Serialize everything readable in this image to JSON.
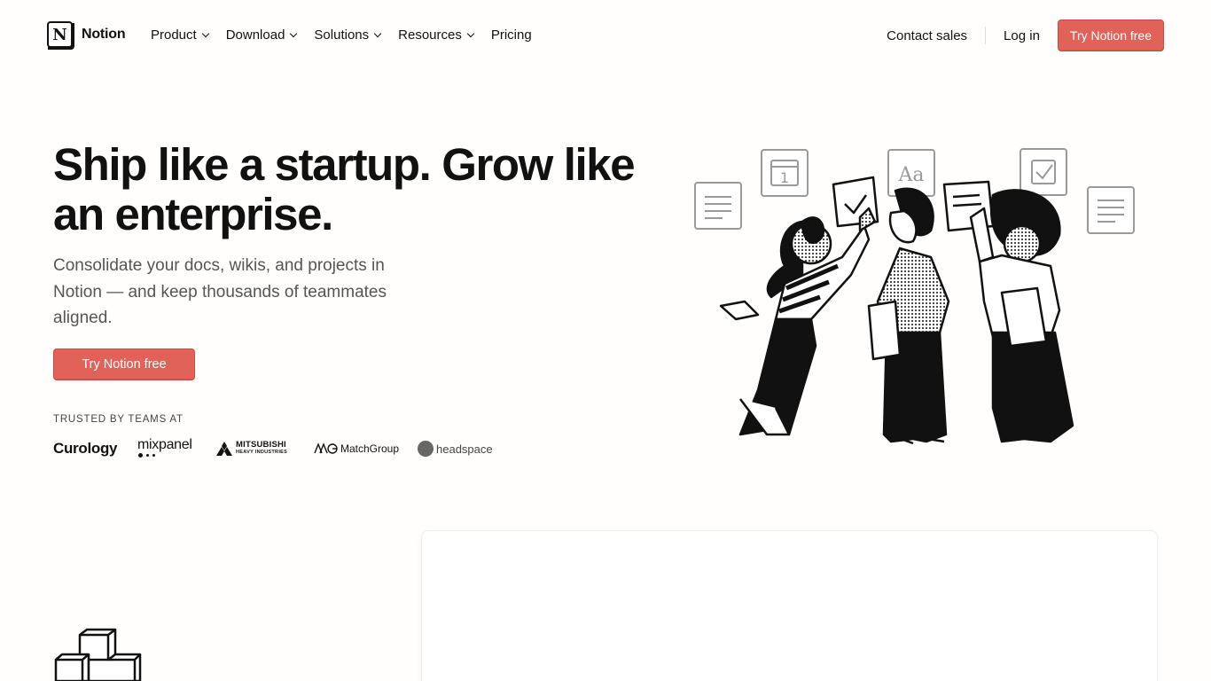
{
  "nav": {
    "logo_text": "Notion",
    "logo_glyph": "N",
    "menu": [
      {
        "label": "Product",
        "has_dropdown": true
      },
      {
        "label": "Download",
        "has_dropdown": true
      },
      {
        "label": "Solutions",
        "has_dropdown": true
      },
      {
        "label": "Resources",
        "has_dropdown": true
      },
      {
        "label": "Pricing",
        "has_dropdown": false
      }
    ],
    "contact_sales": "Contact sales",
    "login": "Log in",
    "cta": "Try Notion free"
  },
  "hero": {
    "headline": "Ship like a startup. Grow like an enterprise.",
    "subheadline": "Consolidate your docs, wikis, and projects in Notion — and keep thousands of teammates aligned.",
    "cta": "Try Notion free",
    "trusted_label": "TRUSTED BY TEAMS AT",
    "logos": {
      "curology": "Curology",
      "mixpanel": "mixpanel",
      "mitsubishi": "MITSUBISHI",
      "mitsubishi_sub": "HEAVY INDUSTRIES",
      "matchgroup": "MatchGroup",
      "headspace": "headspace"
    },
    "illustration_calendar_day": "1",
    "illustration_type_glyph": "Aa"
  },
  "colors": {
    "accent": "#e16259",
    "background": "#fffefc",
    "text": "#111111",
    "muted": "#555555"
  }
}
